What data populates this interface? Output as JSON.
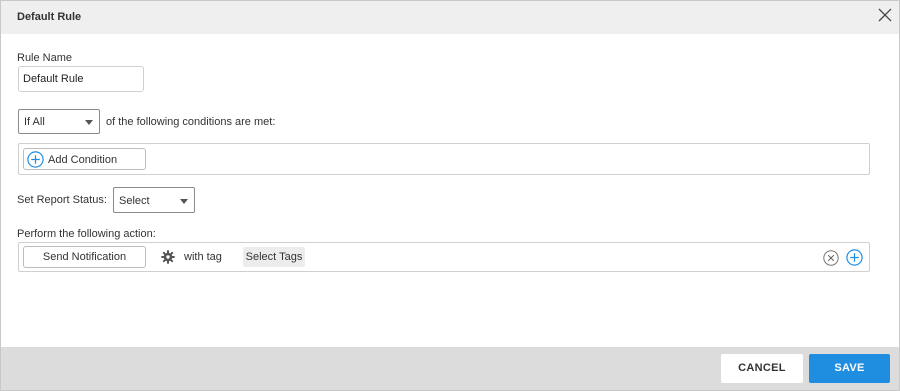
{
  "dialog": {
    "title": "Default Rule",
    "close_icon": "close-icon"
  },
  "rule_name": {
    "label": "Rule Name",
    "value": "Default Rule"
  },
  "conditions": {
    "match_select_value": "If All",
    "suffix_text": "of the following conditions are met:",
    "add_condition_label": "Add Condition",
    "add_icon": "plus-circle-icon"
  },
  "report_status": {
    "label": "Set Report Status:",
    "select_value": "Select"
  },
  "action": {
    "label": "Perform the following action:",
    "action_button_label": "Send Notification",
    "settings_icon": "gear-icon",
    "with_tag_text": "with tag",
    "tags_placeholder": "Select Tags",
    "remove_icon": "close-circle-icon",
    "add_icon": "plus-circle-icon"
  },
  "footer": {
    "cancel_label": "CANCEL",
    "save_label": "SAVE"
  },
  "colors": {
    "accent": "#1f8ee0",
    "header_bg": "#efefef",
    "footer_bg": "#dcdcdc"
  }
}
